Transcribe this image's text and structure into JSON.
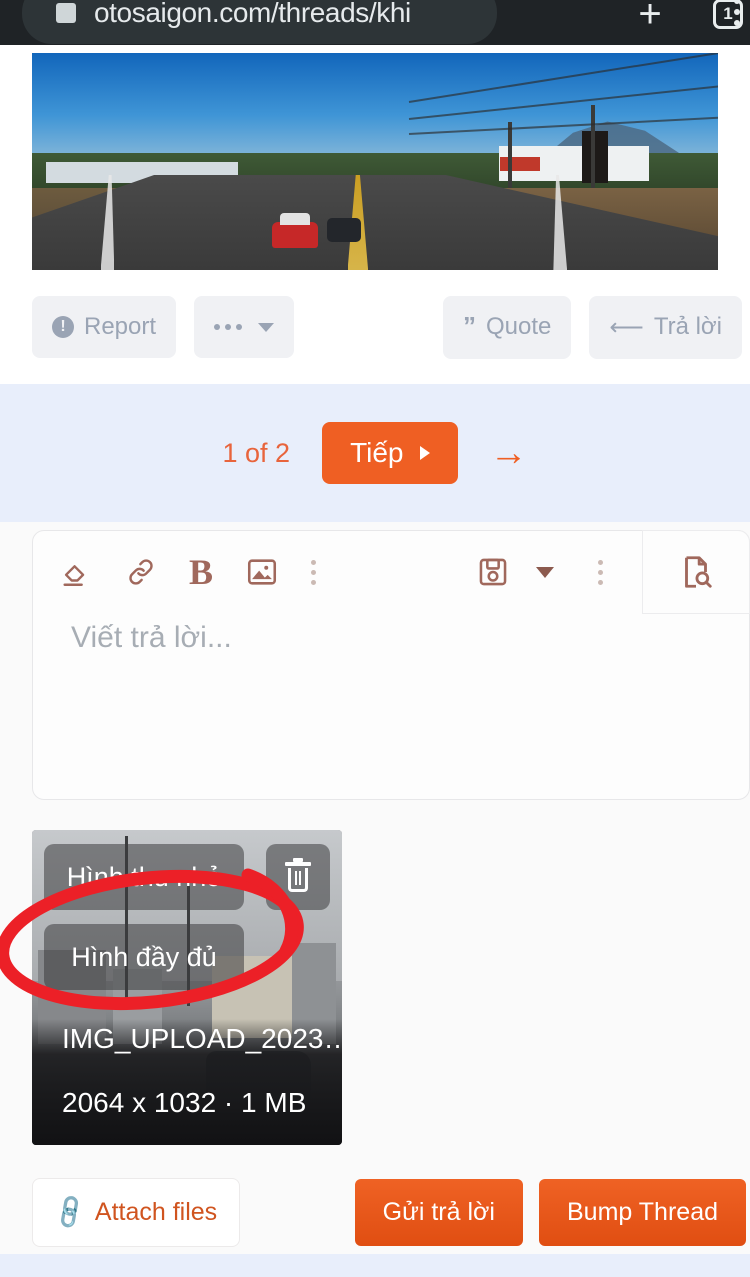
{
  "browser": {
    "url": "otosaigon.com/threads/khi",
    "page_icon": "page-icon",
    "new_tab_label": "+",
    "tab_count": "1",
    "menu_icon": "overflow-menu-icon"
  },
  "post": {
    "image_alt": "highway-photo",
    "actions": {
      "report": "Report",
      "more": "",
      "quote": "Quote",
      "reply": "Trả lời"
    }
  },
  "pagination": {
    "page_label": "1 of 2",
    "next_label": "Tiếp",
    "jump_arrow": "→"
  },
  "editor": {
    "placeholder": "Viết trả lời...",
    "tools": [
      {
        "name": "remove-format-icon",
        "label": ""
      },
      {
        "name": "link-icon",
        "label": ""
      },
      {
        "name": "bold-icon",
        "label": "B"
      },
      {
        "name": "image-icon",
        "label": ""
      },
      {
        "name": "more-tools-icon",
        "label": ""
      }
    ],
    "right_tools": [
      {
        "name": "save-draft-icon",
        "label": ""
      },
      {
        "name": "more-options-icon",
        "label": ""
      },
      {
        "name": "preview-icon",
        "label": ""
      }
    ]
  },
  "attachment": {
    "thumbnail_label": "Hình thu nhỏ",
    "full_label": "Hình đầy đủ",
    "delete_label": "",
    "file_name": "IMG_UPLOAD_2023…",
    "file_meta": "2064 x 1032 · 1 MB"
  },
  "bottom": {
    "attach_label": "Attach files",
    "submit_label": "Gửi trả lời",
    "bump_label": "Bump Thread"
  },
  "colors": {
    "accent_orange": "#ef5f23",
    "pagination_bg": "#e8eefb",
    "toolbar_icon": "#a0685c",
    "annotation_red": "#ec2027",
    "browser_bg": "#1f2326"
  }
}
